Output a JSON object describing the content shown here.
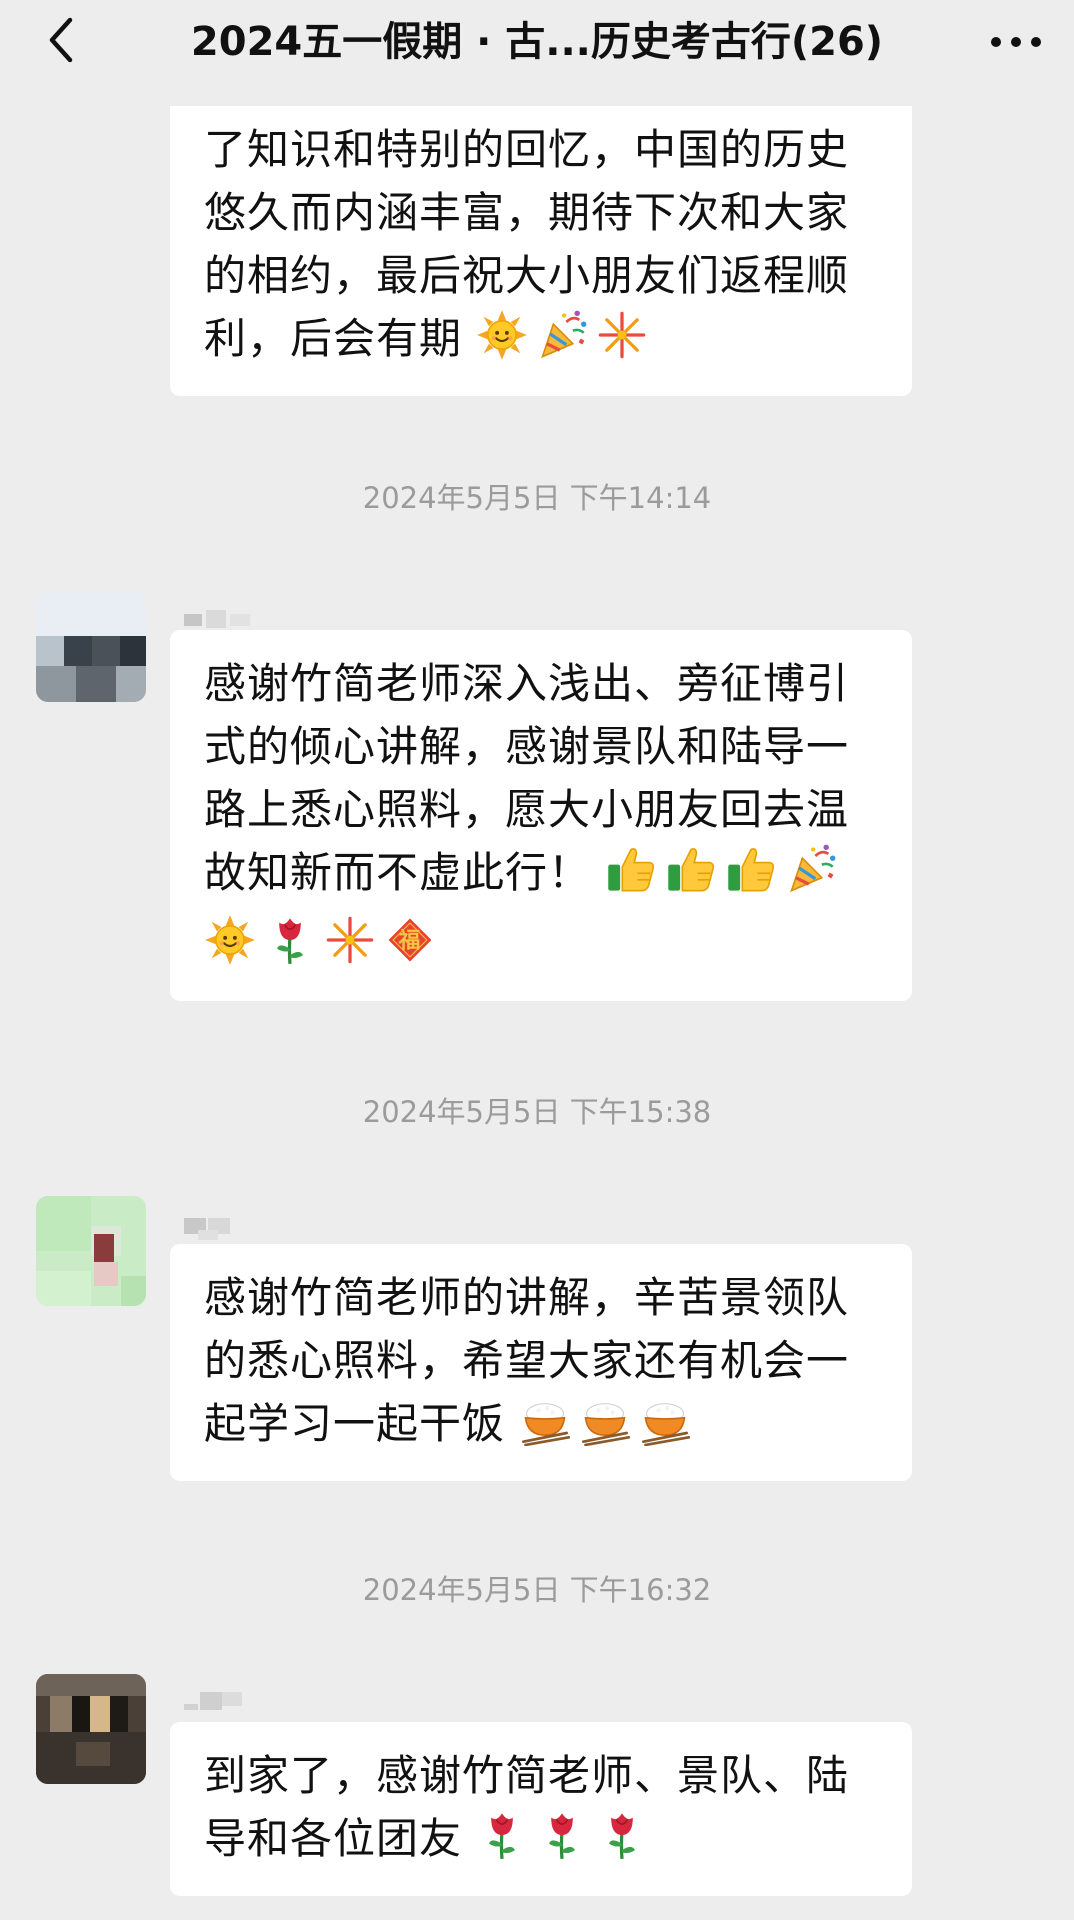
{
  "header": {
    "title": "2024五一假期 · 古...历史考古行(26)",
    "back_icon": "chevron-left-icon",
    "more_icon": "more-dots-icon"
  },
  "messages": [
    {
      "text": "了知识和特别的回忆，中国的历史悠久而内涵丰富，期待下次和大家的相约，最后祝大小朋友们返程顺利，后会有期",
      "emojis": [
        "sun-icon",
        "party-popper-icon",
        "fireworks-icon"
      ]
    },
    {
      "time": "2024年5月5日 下午14:14",
      "text": "感谢竹简老师深入浅出、旁征博引式的倾心讲解，感谢景队和陆导一路上悉心照料，愿大小朋友回去温故知新而不虚此行！",
      "emojis": [
        "thumbs-up-icon",
        "thumbs-up-icon",
        "thumbs-up-icon",
        "party-popper-icon",
        "sun-icon",
        "rose-icon",
        "fireworks-icon",
        "fu-icon"
      ]
    },
    {
      "time": "2024年5月5日 下午15:38",
      "text": "感谢竹简老师的讲解，辛苦景领队的悉心照料，希望大家还有机会一起学习一起干饭",
      "emojis": [
        "rice-bowl-icon",
        "rice-bowl-icon",
        "rice-bowl-icon"
      ]
    },
    {
      "time": "2024年5月5日 下午16:32",
      "text": "到家了，感谢竹简老师、景队、陆导和各位团友",
      "emojis": [
        "rose-icon",
        "rose-icon",
        "rose-icon"
      ]
    }
  ],
  "colors": {
    "background": "#ededed",
    "bubble": "#ffffff",
    "time_text": "#9b9b9b"
  }
}
